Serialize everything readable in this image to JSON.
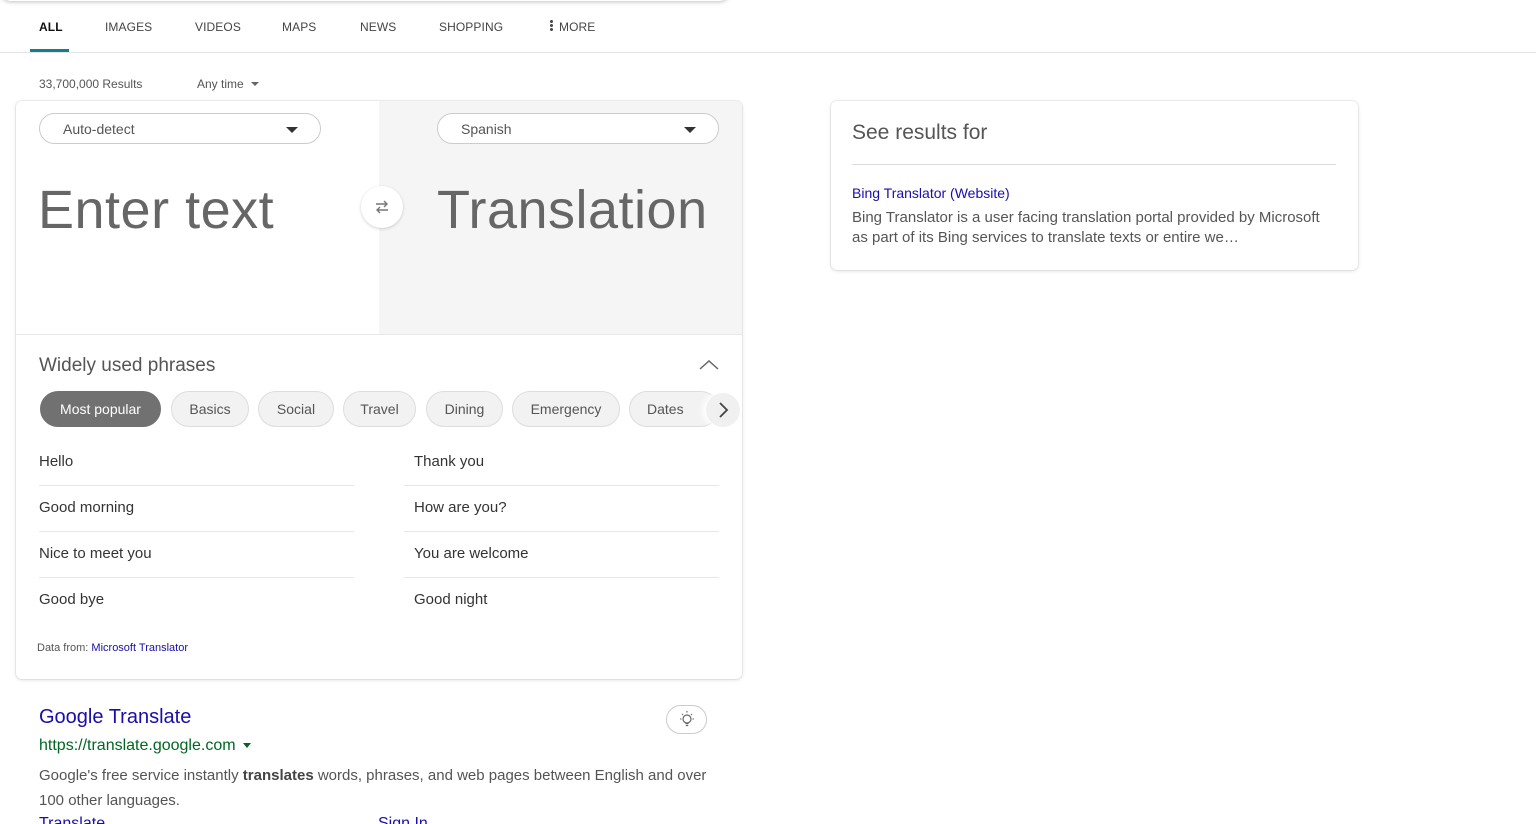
{
  "nav": {
    "tabs": [
      {
        "label": "ALL",
        "active": true
      },
      {
        "label": "IMAGES",
        "active": false
      },
      {
        "label": "VIDEOS",
        "active": false
      },
      {
        "label": "MAPS",
        "active": false
      },
      {
        "label": "NEWS",
        "active": false
      },
      {
        "label": "SHOPPING",
        "active": false
      }
    ],
    "more_label": "MORE"
  },
  "results_info": {
    "count": "33,700,000 Results",
    "time_filter": "Any time"
  },
  "translator": {
    "source_language": "Auto-detect",
    "target_language": "Spanish",
    "input_placeholder": "Enter text",
    "output_placeholder": "Translation",
    "phrases_title": "Widely used phrases",
    "categories": [
      "Most popular",
      "Basics",
      "Social",
      "Travel",
      "Dining",
      "Emergency",
      "Dates"
    ],
    "active_category": "Most popular",
    "phrases_left": [
      "Hello",
      "Good morning",
      "Nice to meet you",
      "Good bye"
    ],
    "phrases_right": [
      "Thank you",
      "How are you?",
      "You are welcome",
      "Good night"
    ],
    "data_from_label": "Data from:",
    "data_from_source": "Microsoft Translator"
  },
  "see_results": {
    "title": "See results for",
    "link": "Bing Translator (Website)",
    "description": "Bing Translator is a user facing translation portal provided by Microsoft as part of its Bing services to translate texts or entire we…"
  },
  "result": {
    "title": "Google Translate",
    "url": "https://translate.google.com",
    "snippet_pre": "Google's free service instantly ",
    "snippet_bold": "translates",
    "snippet_post": " words, phrases, and web pages between English and over 100 other languages.",
    "sublinks": [
      "Translate",
      "Sign In"
    ]
  },
  "colors": {
    "link": "#1a0dab",
    "url_green": "#006621",
    "tab_accent": "#177e89",
    "chip_active": "#717171"
  }
}
